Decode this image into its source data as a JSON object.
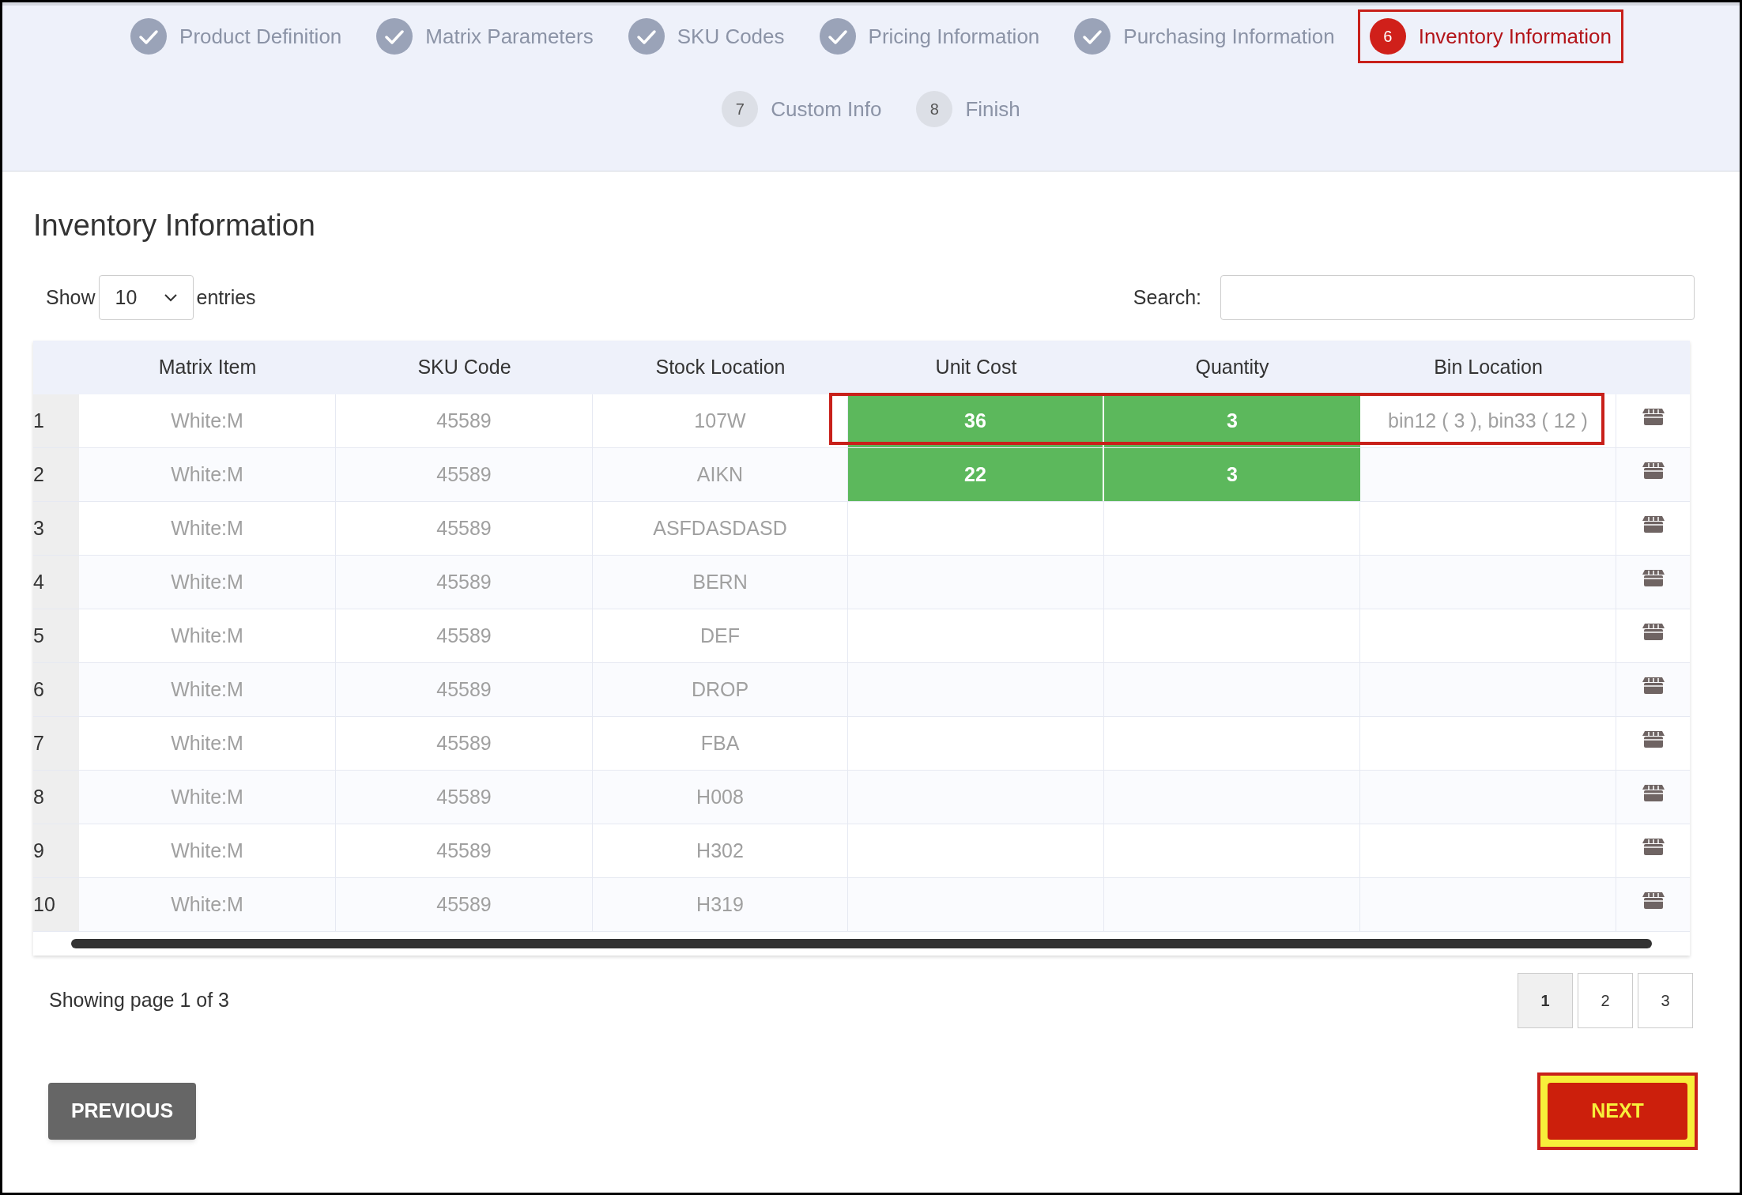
{
  "steps": [
    {
      "label": "Product Definition",
      "kind": "done",
      "highlighted": false
    },
    {
      "label": "Matrix Parameters",
      "kind": "done",
      "highlighted": false
    },
    {
      "label": "SKU Codes",
      "kind": "done",
      "highlighted": false
    },
    {
      "label": "Pricing Information",
      "kind": "done",
      "highlighted": false
    },
    {
      "label": "Purchasing Information",
      "kind": "done",
      "highlighted": false
    },
    {
      "number": "6",
      "label": "Inventory Information",
      "kind": "active",
      "highlighted": true
    },
    {
      "number": "7",
      "label": "Custom Info",
      "kind": "pending",
      "highlighted": false
    },
    {
      "number": "8",
      "label": "Finish",
      "kind": "pending",
      "highlighted": false
    }
  ],
  "title": "Inventory Information",
  "length": {
    "show": "Show",
    "value": "10",
    "entries": "entries"
  },
  "search": {
    "label": "Search:"
  },
  "table": {
    "columns": [
      "Matrix Item",
      "SKU Code",
      "Stock Location",
      "Unit Cost",
      "Quantity",
      "Bin Location"
    ],
    "rows": [
      {
        "index": "1",
        "matrix_item": "White:M",
        "sku": "45589",
        "location": "107W",
        "unit_cost": "36",
        "quantity": "3",
        "bin": "bin12 ( 3 ), bin33 ( 12 )",
        "highlighted": true
      },
      {
        "index": "2",
        "matrix_item": "White:M",
        "sku": "45589",
        "location": "AIKN",
        "unit_cost": "22",
        "quantity": "3",
        "highlighted": false
      },
      {
        "index": "3",
        "matrix_item": "White:M",
        "sku": "45589",
        "location": "ASFDASDASD",
        "highlighted": false
      },
      {
        "index": "4",
        "matrix_item": "White:M",
        "sku": "45589",
        "location": "BERN",
        "highlighted": false
      },
      {
        "index": "5",
        "matrix_item": "White:M",
        "sku": "45589",
        "location": "DEF",
        "highlighted": false
      },
      {
        "index": "6",
        "matrix_item": "White:M",
        "sku": "45589",
        "location": "DROP",
        "highlighted": false
      },
      {
        "index": "7",
        "matrix_item": "White:M",
        "sku": "45589",
        "location": "FBA",
        "highlighted": false
      },
      {
        "index": "8",
        "matrix_item": "White:M",
        "sku": "45589",
        "location": "H008",
        "highlighted": false
      },
      {
        "index": "9",
        "matrix_item": "White:M",
        "sku": "45589",
        "location": "H302",
        "highlighted": false
      },
      {
        "index": "10",
        "matrix_item": "White:M",
        "sku": "45589",
        "location": "H319",
        "highlighted": false
      }
    ]
  },
  "info": "Showing page 1 of 3",
  "pages": [
    {
      "label": "1",
      "selected": true
    },
    {
      "label": "2",
      "selected": false
    },
    {
      "label": "3",
      "selected": false
    }
  ],
  "previous": "PREVIOUS",
  "next": {
    "label": "NEXT",
    "highlighted": true
  }
}
